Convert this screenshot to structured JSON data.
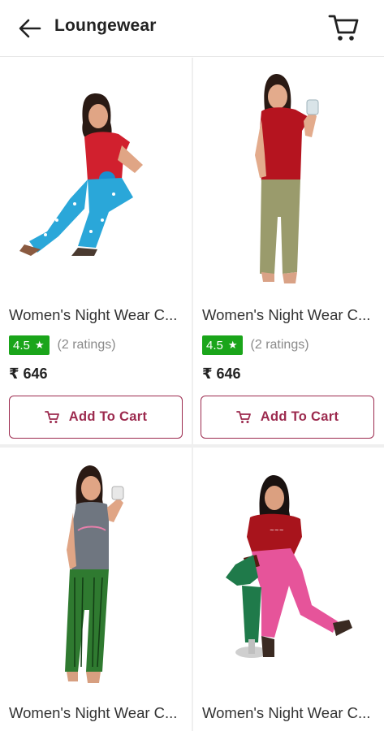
{
  "header": {
    "title": "Loungewear",
    "back_icon": "arrow-left-icon",
    "cart_icon": "cart-icon"
  },
  "colors": {
    "accent": "#9c2a4e",
    "rating_green": "#1aa51a"
  },
  "products": [
    {
      "name": "Women's Night Wear C...",
      "rating": "4.5",
      "ratings_count": "(2 ratings)",
      "price": "₹ 646",
      "add_label": "Add To Cart",
      "top_color": "#d1202e",
      "bottom_color": "#2aa7d9"
    },
    {
      "name": "Women's Night Wear C...",
      "rating": "4.5",
      "ratings_count": "(2 ratings)",
      "price": "₹ 646",
      "add_label": "Add To Cart",
      "top_color": "#b5141f",
      "bottom_color": "#9a9b6c"
    },
    {
      "name": "Women's Night Wear C...",
      "top_color": "#6f7680",
      "bottom_color": "#2f7a30"
    },
    {
      "name": "Women's Night Wear C...",
      "top_color": "#a8141c",
      "bottom_color": "#e6549a"
    }
  ]
}
